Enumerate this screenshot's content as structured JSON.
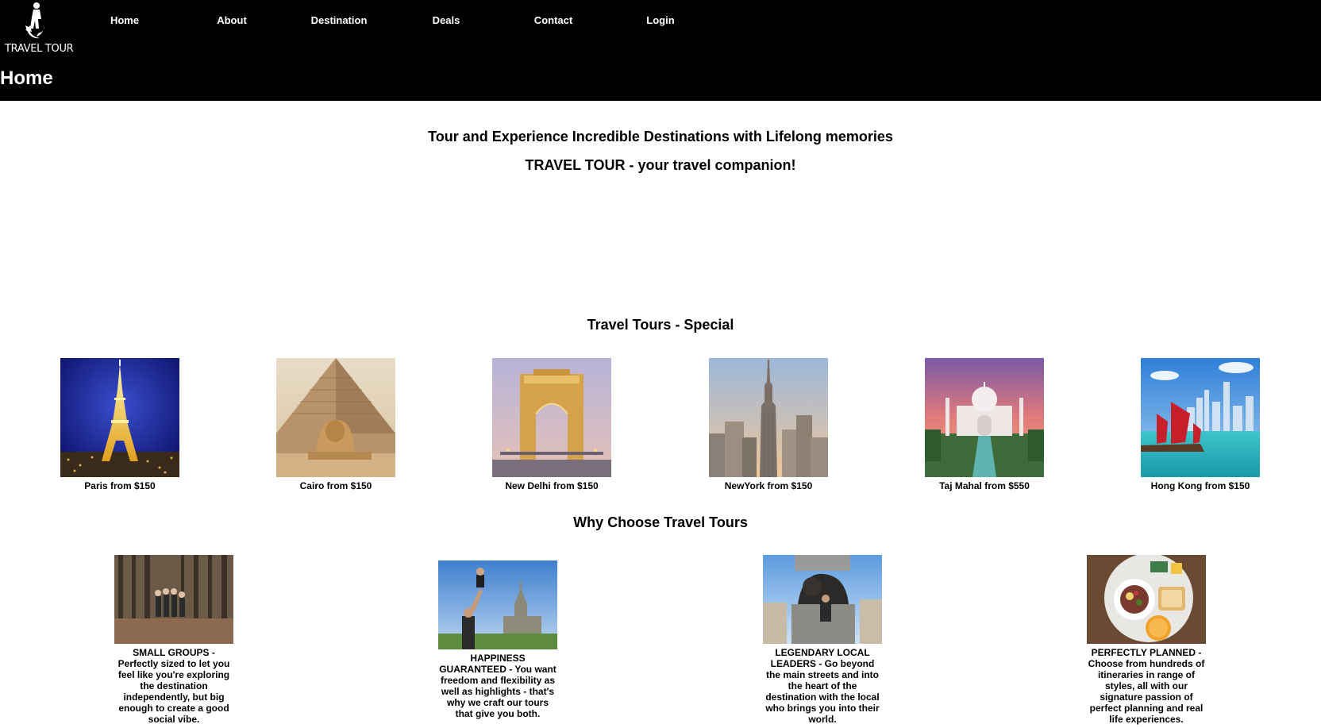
{
  "header": {
    "logo_text": "TRAVEL TOUR",
    "nav": [
      "Home",
      "About",
      "Destination",
      "Deals",
      "Contact",
      "Login"
    ],
    "page_title": "Home"
  },
  "hero": {
    "line1": "Tour and Experience Incredible Destinations with Lifelong memories",
    "line2": "TRAVEL TOUR - your travel companion!"
  },
  "specials": {
    "title": "Travel Tours - Special",
    "items": [
      {
        "caption": "Paris from $150",
        "image": "eiffel-tower-image"
      },
      {
        "caption": "Cairo from $150",
        "image": "sphinx-pyramid-image"
      },
      {
        "caption": "New Delhi from $150",
        "image": "india-gate-image"
      },
      {
        "caption": "NewYork from $150",
        "image": "empire-state-image"
      },
      {
        "caption": "Taj Mahal from $550",
        "image": "taj-mahal-image"
      },
      {
        "caption": "Hong Kong from $150",
        "image": "hong-kong-junk-image"
      }
    ]
  },
  "why": {
    "title": "Why Choose Travel Tours",
    "items": [
      {
        "text": "SMALL GROUPS - Perfectly sized to let you feel like you're exploring the destination independently, but big enough to create a good social vibe.",
        "image": "forest-group-image"
      },
      {
        "text": "HAPPINESS GUARANTEED - You want freedom and flexibility as well as highlights - that's why we craft our tours that give you both.",
        "image": "father-child-image"
      },
      {
        "text": "LEGENDARY LOCAL LEADERS - Go beyond the main streets and into the heart of the destination with the local who brings you into their world.",
        "image": "lion-statue-image"
      },
      {
        "text": "PERFECTLY PLANNED - Choose from hundreds of itineraries in range of styles, all with our signature passion of perfect planning and real life experiences.",
        "image": "breakfast-plate-image"
      }
    ]
  },
  "colors": {
    "header_bg": "#000000",
    "page_bg": "#ffffff",
    "text": "#000000"
  }
}
